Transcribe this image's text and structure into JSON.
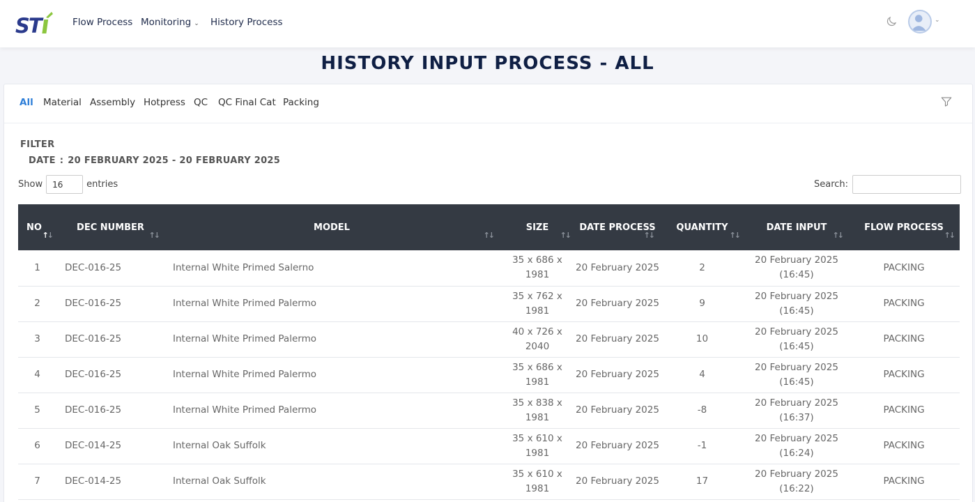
{
  "nav": {
    "brand": "STI",
    "links": [
      {
        "label": "Flow Process",
        "dropdown": false
      },
      {
        "label": "Monitoring",
        "dropdown": true
      },
      {
        "label": "History Process",
        "dropdown": false
      }
    ],
    "theme_icon": "moon-icon",
    "avatar_icon": "user-avatar-icon"
  },
  "page": {
    "title": "HISTORY INPUT PROCESS - ALL"
  },
  "tabs": [
    "All",
    "Material",
    "Assembly",
    "Hotpress",
    "QC",
    "QC Final Cat",
    "Packing"
  ],
  "active_tab": "All",
  "filter": {
    "label": "FILTER",
    "date_key": "DATE",
    "date_value": "20 FEBRUARY 2025 - 20 FEBRUARY 2025"
  },
  "controls": {
    "show_label": "Show",
    "show_value": "16",
    "entries_label": "entries",
    "search_label": "Search:",
    "search_value": ""
  },
  "table": {
    "columns": [
      "NO",
      "DEC NUMBER",
      "MODEL",
      "SIZE",
      "DATE PROCESS",
      "QUANTITY",
      "DATE INPUT",
      "FLOW PROCESS"
    ],
    "rows": [
      [
        "1",
        "DEC-016-25",
        "Internal White Primed Salerno",
        "35 x 686 x 1981",
        "20 February 2025",
        "2",
        "20 February 2025 (16:45)",
        "PACKING"
      ],
      [
        "2",
        "DEC-016-25",
        "Internal White Primed Palermo",
        "35 x 762 x 1981",
        "20 February 2025",
        "9",
        "20 February 2025 (16:45)",
        "PACKING"
      ],
      [
        "3",
        "DEC-016-25",
        "Internal White Primed Palermo",
        "40 x 726 x 2040",
        "20 February 2025",
        "10",
        "20 February 2025 (16:45)",
        "PACKING"
      ],
      [
        "4",
        "DEC-016-25",
        "Internal White Primed Palermo",
        "35 x 686 x 1981",
        "20 February 2025",
        "4",
        "20 February 2025 (16:45)",
        "PACKING"
      ],
      [
        "5",
        "DEC-016-25",
        "Internal White Primed Palermo",
        "35 x 838 x 1981",
        "20 February 2025",
        "-8",
        "20 February 2025 (16:37)",
        "PACKING"
      ],
      [
        "6",
        "DEC-014-25",
        "Internal Oak Suffolk",
        "35 x 610 x 1981",
        "20 February 2025",
        "-1",
        "20 February 2025 (16:24)",
        "PACKING"
      ],
      [
        "7",
        "DEC-014-25",
        "Internal Oak Suffolk",
        "35 x 610 x 1981",
        "20 February 2025",
        "17",
        "20 February 2025 (16:22)",
        "PACKING"
      ]
    ]
  },
  "colors": {
    "brand_navy": "#2a3a8c",
    "brand_green": "#8cc63f",
    "active_tab": "#2f7fd8",
    "table_header": "#343a43"
  }
}
